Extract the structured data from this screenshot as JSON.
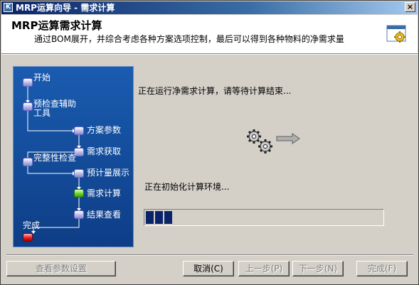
{
  "window": {
    "title": "MRP运算向导 - 需求计算",
    "close_label": "×"
  },
  "header": {
    "title": "MRP运算需求计算",
    "subtitle": "通过BOM展开，并综合考虑各种方案选项控制，最后可以得到各种物料的净需求量"
  },
  "flow": {
    "steps": [
      {
        "label": "开始",
        "state": "normal"
      },
      {
        "label": "预检查辅助工具",
        "state": "normal"
      },
      {
        "label": "方案参数",
        "state": "normal"
      },
      {
        "label": "需求获取",
        "state": "normal"
      },
      {
        "label": "完整性检查",
        "state": "normal"
      },
      {
        "label": "预计量展示",
        "state": "normal"
      },
      {
        "label": "需求计算",
        "state": "active"
      },
      {
        "label": "结果查看",
        "state": "normal"
      },
      {
        "label": "完成",
        "state": "end"
      }
    ],
    "colors": {
      "panel": "#1a5cb0",
      "active": "#6ed42a",
      "end": "#e82020"
    }
  },
  "content": {
    "status_main": "正在运行净需求计算，请等待计算结束...",
    "status_sub": "正在初始化计算环境...",
    "progress_blocks": 3
  },
  "buttons": {
    "view_params": "查看参数设置",
    "cancel": "取消(C)",
    "prev": "上一步(P)",
    "next": "下一步(N)",
    "finish": "完成(F)"
  }
}
